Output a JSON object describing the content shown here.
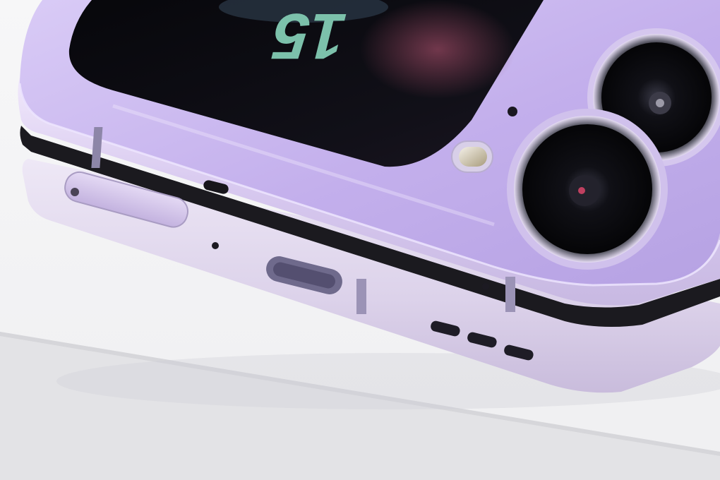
{
  "photo": {
    "cover_screen_text": "15",
    "colors": {
      "table_top": "#f3f3f4",
      "table_edge": "#dcdcde",
      "body_lavender": "#c6b3ec",
      "frame_silver_lilac": "#d6cbe6",
      "hinge_black": "#1b1a1f",
      "cover_screen_black": "#0d0c12",
      "lens_ring": "#2a2830",
      "antenna_line": "#8d86a8"
    }
  }
}
